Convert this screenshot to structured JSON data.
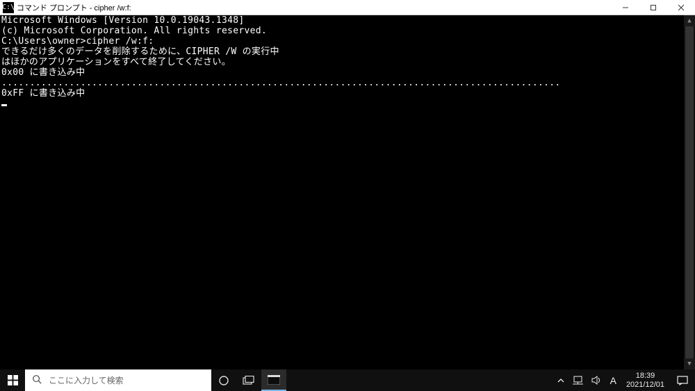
{
  "window": {
    "icon_label": "C:\\",
    "title": "コマンド プロンプト - cipher  /w:f:"
  },
  "terminal": {
    "lines": [
      "Microsoft Windows [Version 10.0.19043.1348]",
      "(c) Microsoft Corporation. All rights reserved.",
      "",
      "C:\\Users\\owner>cipher /w:f:",
      "できるだけ多くのデータを削除するために、CIPHER /W の実行中",
      "はほかのアプリケーションをすべて終了してください。",
      "0x00 に書き込み中",
      "...................................................................................................",
      "0xFF に書き込み中"
    ]
  },
  "taskbar": {
    "search_placeholder": "ここに入力して検索",
    "ime_label": "A",
    "clock_time": "18:39",
    "clock_date": "2021/12/01"
  }
}
